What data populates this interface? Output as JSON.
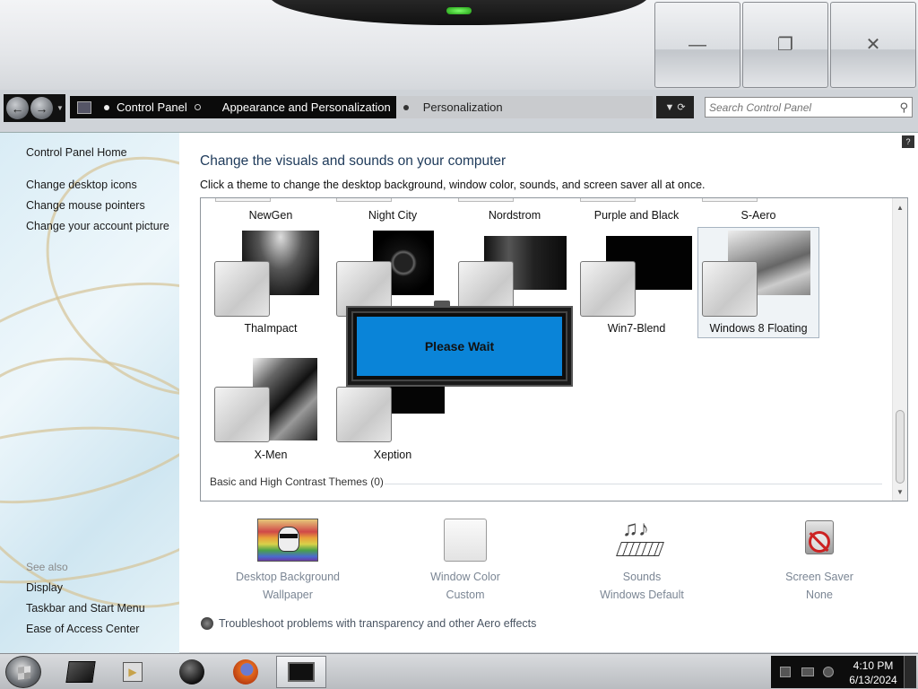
{
  "window": {
    "minimize_icon": "minimize-icon",
    "maximize_icon": "maximize-icon",
    "close_icon": "close-icon"
  },
  "address": {
    "crumbs": [
      "Control Panel",
      "Appearance and Personalization",
      "Personalization"
    ],
    "search_placeholder": "Search Control Panel",
    "deco_text": "anel"
  },
  "sidebar": {
    "home": "Control Panel Home",
    "links": [
      "Change desktop icons",
      "Change mouse pointers",
      "Change your account picture"
    ],
    "see_also_label": "See also",
    "see_also": [
      "Display",
      "Taskbar and Start Menu",
      "Ease of Access Center"
    ]
  },
  "main": {
    "heading": "Change the visuals and sounds on your computer",
    "subheading": "Click a theme to change the desktop background, window color, sounds, and screen saver all at once."
  },
  "themes": {
    "row1": [
      "NewGen",
      "Night City",
      "Nordstrom",
      "Purple and Black",
      "S-Aero"
    ],
    "row2": [
      "ThaImpact",
      "",
      "",
      "Win7-Blend",
      "Windows 8 Floating"
    ],
    "row3": [
      "X-Men",
      "Xeption"
    ],
    "selected": "Windows 8 Floating",
    "group_label": "Basic and High Contrast Themes (0)"
  },
  "dialog": {
    "please_wait": "Please Wait"
  },
  "bottom": [
    {
      "title": "Desktop Background",
      "value": "Wallpaper",
      "icon": "desktop-background-icon"
    },
    {
      "title": "Window Color",
      "value": "Custom",
      "icon": "window-color-icon"
    },
    {
      "title": "Sounds",
      "value": "Windows Default",
      "icon": "sounds-icon"
    },
    {
      "title": "Screen Saver",
      "value": "None",
      "icon": "screen-saver-icon"
    }
  ],
  "troubleshoot": "Troubleshoot problems with transparency and other Aero effects",
  "taskbar": {
    "time": "4:10 PM",
    "date": "6/13/2024"
  },
  "colors": {
    "accent": "#0a84d8",
    "heading": "#1e3a5a"
  }
}
